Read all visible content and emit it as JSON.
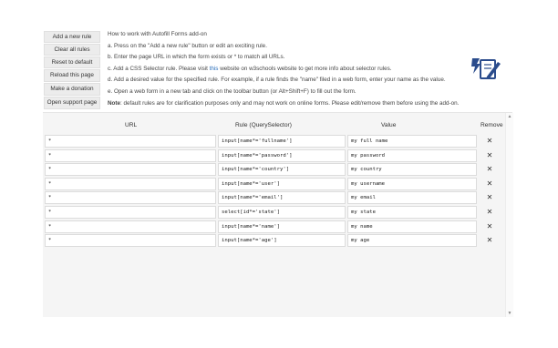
{
  "sidebar": {
    "buttons": [
      {
        "label": "Add a new rule"
      },
      {
        "label": "Clear all rules"
      },
      {
        "label": "Reset to default"
      },
      {
        "label": "Reload this page"
      },
      {
        "label": "Make a donation"
      },
      {
        "label": "Open support page"
      }
    ]
  },
  "instructions": {
    "title": "How to work with Autofill Forms add-on",
    "a": "a. Press on the \"Add a new rule\" button or edit an exciting rule.",
    "b": "b. Enter the page URL in which the form exists or * to match all URLs.",
    "c_pre": "c. Add a CSS Selector rule. Please visit ",
    "c_link": "this",
    "c_post": " website on w3schools website to get more info about selector rules.",
    "d": "d. Add a desired value for the specified rule. For example, if a rule finds the \"name\" filed in a web form, enter your name as the value.",
    "e": "e. Open a web form in a new tab and click on the toolbar button (or Alt+Shift+F) to fill out the form.",
    "note_label": "Note",
    "note_text": ": default rules are for clarification purposes only and may not work on online forms. Please edit/remove them before using the add-on."
  },
  "logo": {
    "icon": "autofill-pen-icon",
    "color": "#2b4c8c"
  },
  "table": {
    "headers": {
      "url": "URL",
      "rule": "Rule (QuerySelector)",
      "value": "Value",
      "remove": "Remove"
    },
    "remove_symbol": "✕",
    "rows": [
      {
        "url": "*",
        "rule": "input[name*='fullname']",
        "value": "my full name"
      },
      {
        "url": "*",
        "rule": "input[name*='password']",
        "value": "my password"
      },
      {
        "url": "*",
        "rule": "input[name*='country']",
        "value": "my country"
      },
      {
        "url": "*",
        "rule": "input[name*='user']",
        "value": "my username"
      },
      {
        "url": "*",
        "rule": "input[name*='email']",
        "value": "my email"
      },
      {
        "url": "*",
        "rule": "select[id*='state']",
        "value": "my state"
      },
      {
        "url": "*",
        "rule": "input[name*='name']",
        "value": "my name"
      },
      {
        "url": "*",
        "rule": "input[name*='age']",
        "value": "my age"
      }
    ]
  }
}
